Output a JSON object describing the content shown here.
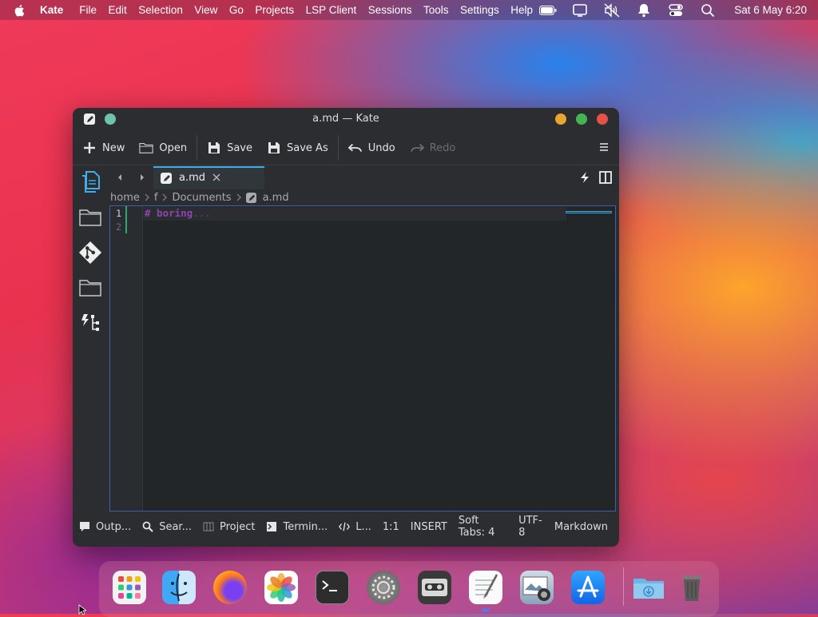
{
  "menubar": {
    "app_name": "Kate",
    "items": [
      "File",
      "Edit",
      "Selection",
      "View",
      "Go",
      "Projects",
      "LSP Client",
      "Sessions",
      "Tools",
      "Settings",
      "Help"
    ],
    "clock": "Sat 6 May 6:20",
    "tray_icons": [
      "battery-icon",
      "display-icon",
      "mute-icon",
      "notifications-icon",
      "controls-icon",
      "search-icon"
    ]
  },
  "window": {
    "title": "a.md — Kate"
  },
  "toolbar": {
    "new_label": "New",
    "open_label": "Open",
    "save_label": "Save",
    "save_as_label": "Save As",
    "undo_label": "Undo",
    "redo_label": "Redo"
  },
  "tab": {
    "label": "a.md"
  },
  "breadcrumb": {
    "parts": [
      "home",
      "f",
      "Documents",
      "a.md"
    ]
  },
  "editor": {
    "lines": [
      "1",
      "2"
    ],
    "line1_text": "# boring",
    "line1_dim": "..."
  },
  "statusbar": {
    "output": "Outp...",
    "search": "Sear...",
    "project": "Project",
    "terminal": "Termin...",
    "lsp": "L...",
    "position": "1:1",
    "mode": "INSERT",
    "tabs": "Soft Tabs: 4",
    "encoding": "UTF-8",
    "syntax": "Markdown"
  },
  "dock": {
    "apps": [
      "launchpad-icon",
      "finder-icon",
      "firefox-icon",
      "photos-icon",
      "terminal-icon",
      "system-preferences-icon",
      "tape-recorder-icon",
      "text-editor-icon",
      "screenshot-icon",
      "app-store-icon",
      "downloads-folder-icon",
      "trash-icon"
    ]
  },
  "colors": {
    "accent": "#3daee9",
    "window_bg": "#2b2d30",
    "editor_bg": "#232629",
    "markdown_heading": "#8e44ad"
  }
}
